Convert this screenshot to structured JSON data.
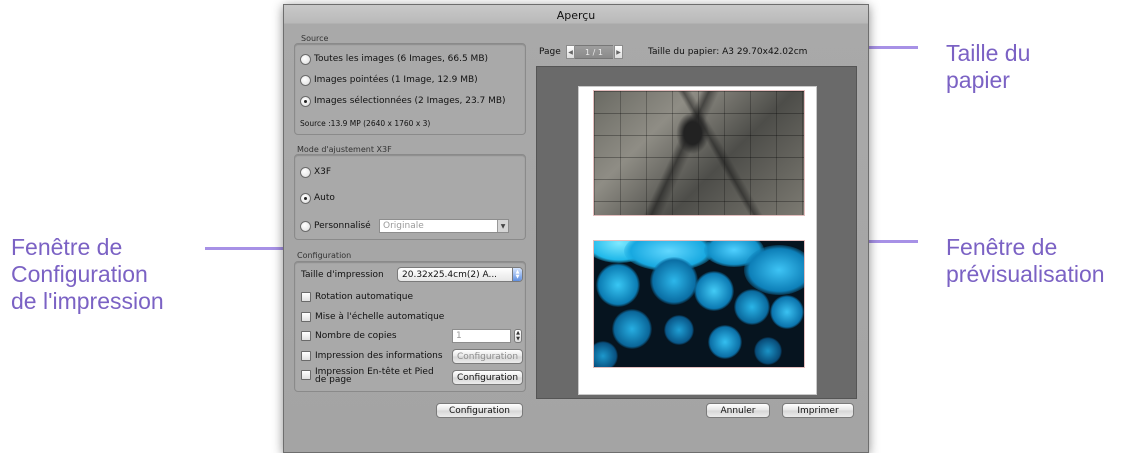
{
  "annotations": {
    "paper_size": [
      "Taille du",
      "papier"
    ],
    "print_config": [
      "Fenêtre de",
      "Configuration",
      "de l'impression"
    ],
    "preview": [
      "Fenêtre de",
      "prévisualisation"
    ]
  },
  "window": {
    "title": "Aperçu"
  },
  "source": {
    "label": "Source",
    "options": [
      {
        "label": "Toutes les images  (6 Images, 66.5 MB)",
        "selected": false
      },
      {
        "label": "Images pointées  (1 Image, 12.9 MB)",
        "selected": false
      },
      {
        "label": "Images sélectionnées  (2 Images, 23.7 MB)",
        "selected": true
      }
    ],
    "info": "Source :13.9 MP (2640 x 1760 x 3)"
  },
  "adjust_mode": {
    "label": "Mode d'ajustement X3F",
    "options": [
      {
        "label": "X3F",
        "selected": false
      },
      {
        "label": "Auto",
        "selected": true
      },
      {
        "label": "Personnalisé",
        "selected": false
      }
    ],
    "custom_select_value": "Originale"
  },
  "configuration": {
    "label": "Configuration",
    "print_size_label": "Taille d'impression",
    "print_size_value": "20.32x25.4cm(2) A...",
    "auto_rotate": "Rotation automatique",
    "auto_scale": "Mise à l'échelle automatique",
    "copies_label": "Nombre de copies",
    "copies_value": "1",
    "print_info": "Impression des informations",
    "print_info_button": "Configuration",
    "header_footer": [
      "Impression En-tête et Pied",
      "de page"
    ],
    "header_footer_button": "Configuration",
    "bottom_button": "Configuration"
  },
  "preview": {
    "page_label": "Page",
    "page_indicator": "1 / 1",
    "paper_label": "Taille du papier:  A3  29.70x42.02cm"
  },
  "buttons": {
    "cancel": "Annuler",
    "print": "Imprimer"
  },
  "colors": {
    "annotation_text": "#7b62c4",
    "annotation_arrow": "#a791e6",
    "window_bg": "#a4a4a4",
    "preview_bg": "#6a6a6a"
  }
}
